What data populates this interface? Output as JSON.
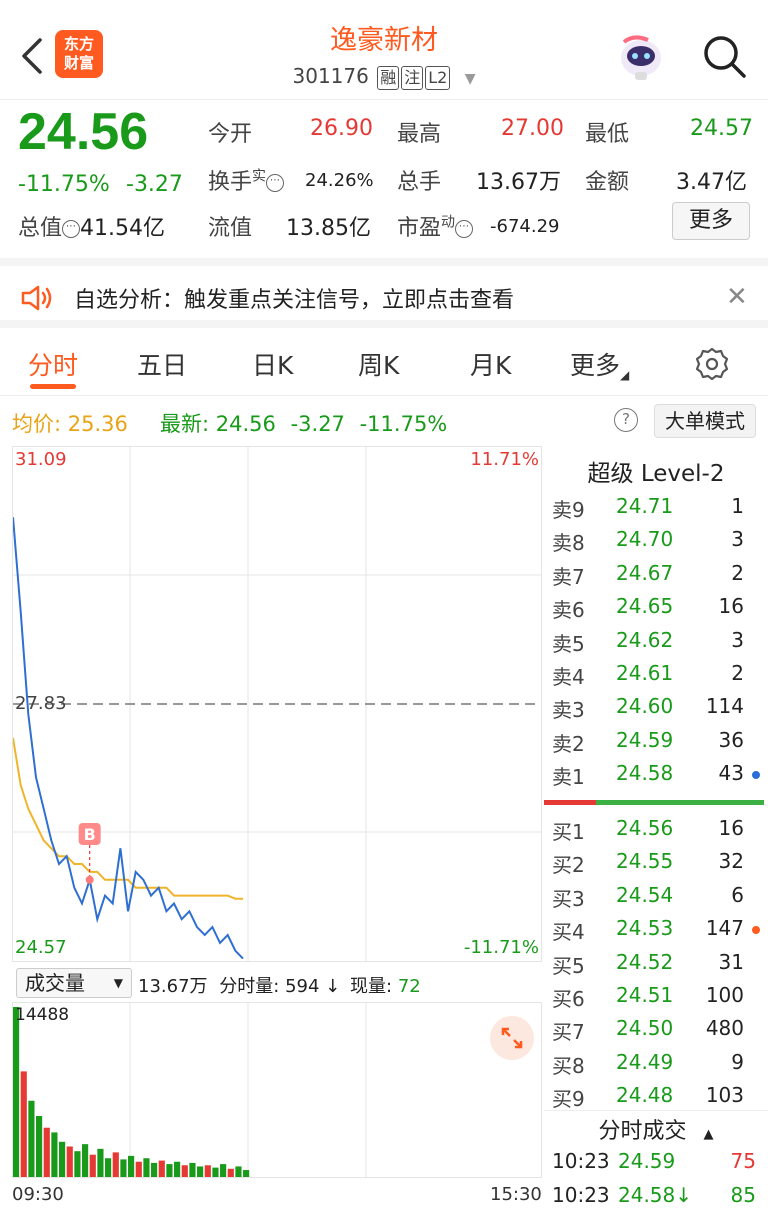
{
  "header": {
    "logo_line1": "东方",
    "logo_line2": "财富",
    "title": "逸豪新材",
    "code": "301176",
    "tags": [
      "融",
      "注",
      "L2"
    ]
  },
  "quote": {
    "price": "24.56",
    "pct": "-11.75%",
    "change": "-3.27",
    "open_label": "今开",
    "open": "26.90",
    "high_label": "最高",
    "high": "27.00",
    "low_label": "最低",
    "low": "24.57",
    "turnover_label": "换手",
    "turnover_sup": "实",
    "turnover": "24.26%",
    "volume_label": "总手",
    "volume": "13.67万",
    "amount_label": "金额",
    "amount": "3.47亿",
    "mktcap_label": "总值",
    "mktcap": "41.54亿",
    "float_label": "流值",
    "float": "13.85亿",
    "pe_label": "市盈",
    "pe_sup": "动",
    "pe": "-674.29",
    "more": "更多"
  },
  "notice": {
    "text": "自选分析：触发重点关注信号，立即点击查看"
  },
  "tabs": [
    "分时",
    "五日",
    "日K",
    "周K",
    "月K",
    "更多"
  ],
  "infobar": {
    "avg_label": "均价:",
    "avg": "25.36",
    "latest_label": "最新:",
    "latest": "24.56",
    "chg": "-3.27",
    "pct": "-11.75%",
    "bigmode": "大单模式"
  },
  "chart_data": {
    "type": "line",
    "y_top": "31.09",
    "y_mid": "27.83",
    "y_bottom": "24.57",
    "pct_top": "11.71%",
    "pct_bottom": "-11.71%",
    "marker": "B",
    "price_series": [
      30.2,
      29.0,
      27.7,
      26.9,
      26.5,
      26.1,
      25.8,
      25.9,
      25.5,
      25.3,
      25.6,
      25.1,
      25.4,
      25.3,
      26.0,
      25.2,
      25.7,
      25.6,
      25.4,
      25.5,
      25.2,
      25.3,
      25.1,
      25.2,
      25.0,
      24.9,
      25.0,
      24.8,
      24.9,
      24.7,
      24.6
    ],
    "avg_series": [
      27.4,
      26.8,
      26.5,
      26.3,
      26.1,
      26.0,
      25.9,
      25.9,
      25.8,
      25.8,
      25.7,
      25.7,
      25.6,
      25.6,
      25.6,
      25.6,
      25.5,
      25.5,
      25.5,
      25.5,
      25.5,
      25.4,
      25.4,
      25.4,
      25.4,
      25.4,
      25.4,
      25.4,
      25.4,
      25.36,
      25.36
    ],
    "volume_max": "14488",
    "volume_series": [
      14488,
      9000,
      6500,
      5200,
      4200,
      3800,
      3000,
      2600,
      2200,
      2800,
      1900,
      2400,
      1600,
      2100,
      1500,
      1800,
      1300,
      1600,
      1200,
      1400,
      1100,
      1300,
      1000,
      1200,
      900,
      1000,
      800,
      1100,
      700,
      900,
      594
    ],
    "time_start": "09:30",
    "time_end": "15:30"
  },
  "volhead": {
    "dropdown": "成交量",
    "total": "13.67万",
    "minute_label": "分时量:",
    "minute": "594",
    "now_label": "现量:",
    "now": "72"
  },
  "level2": {
    "title": "超级 Level-2",
    "asks": [
      {
        "label": "卖9",
        "price": "24.71",
        "vol": "1"
      },
      {
        "label": "卖8",
        "price": "24.70",
        "vol": "3"
      },
      {
        "label": "卖7",
        "price": "24.67",
        "vol": "2"
      },
      {
        "label": "卖6",
        "price": "24.65",
        "vol": "16"
      },
      {
        "label": "卖5",
        "price": "24.62",
        "vol": "3"
      },
      {
        "label": "卖4",
        "price": "24.61",
        "vol": "2"
      },
      {
        "label": "卖3",
        "price": "24.60",
        "vol": "114"
      },
      {
        "label": "卖2",
        "price": "24.59",
        "vol": "36"
      },
      {
        "label": "卖1",
        "price": "24.58",
        "vol": "43"
      }
    ],
    "bids": [
      {
        "label": "买1",
        "price": "24.56",
        "vol": "16"
      },
      {
        "label": "买2",
        "price": "24.55",
        "vol": "32"
      },
      {
        "label": "买3",
        "price": "24.54",
        "vol": "6"
      },
      {
        "label": "买4",
        "price": "24.53",
        "vol": "147"
      },
      {
        "label": "买5",
        "price": "24.52",
        "vol": "31"
      },
      {
        "label": "买6",
        "price": "24.51",
        "vol": "100"
      },
      {
        "label": "买7",
        "price": "24.50",
        "vol": "480"
      },
      {
        "label": "买8",
        "price": "24.49",
        "vol": "9"
      },
      {
        "label": "买9",
        "price": "24.48",
        "vol": "103"
      }
    ],
    "ticks_title": "分时成交",
    "ticks": [
      {
        "time": "10:23",
        "price": "24.59",
        "vol": "75"
      },
      {
        "time": "10:23",
        "price": "24.58↓",
        "vol": "85"
      }
    ]
  }
}
